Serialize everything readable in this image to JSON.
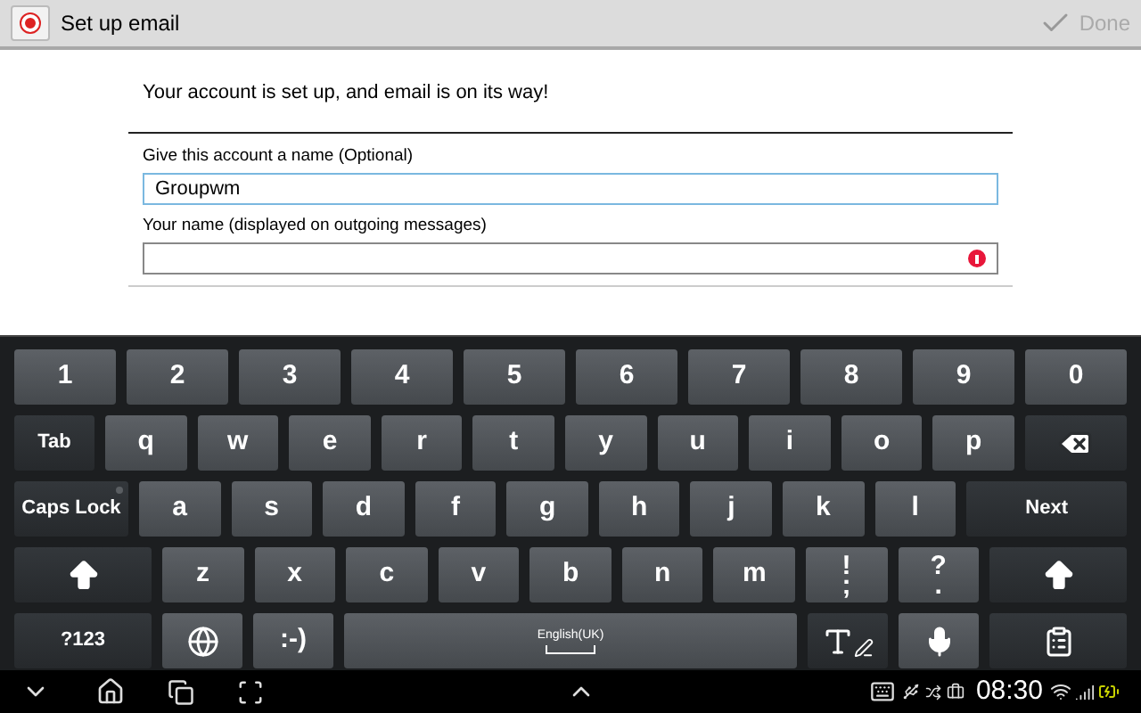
{
  "action_bar": {
    "title": "Set up email",
    "done": {
      "label": "Done",
      "disabled": true
    }
  },
  "message": "Your account is set up, and email is on its way!",
  "fields": [
    {
      "label": "Give this account a name (Optional)",
      "value": "Groupwm",
      "focused": true,
      "error": false
    },
    {
      "label": "Your name (displayed on outgoing messages)",
      "focused": false,
      "error": true
    }
  ],
  "keyboard": {
    "rows": [
      [
        {
          "kind": "digit",
          "label": "1"
        },
        {
          "kind": "digit",
          "label": "2"
        },
        {
          "kind": "digit",
          "label": "3"
        },
        {
          "kind": "digit",
          "label": "4"
        },
        {
          "kind": "digit",
          "label": "5"
        },
        {
          "kind": "digit",
          "label": "6"
        },
        {
          "kind": "digit",
          "label": "7"
        },
        {
          "kind": "digit",
          "label": "8"
        },
        {
          "kind": "digit",
          "label": "9"
        },
        {
          "kind": "digit",
          "label": "0"
        }
      ],
      [
        {
          "kind": "tab",
          "label": "Tab"
        },
        {
          "kind": "char",
          "label": "q"
        },
        {
          "kind": "char",
          "label": "w"
        },
        {
          "kind": "char",
          "label": "e"
        },
        {
          "kind": "char",
          "label": "r"
        },
        {
          "kind": "char",
          "label": "t"
        },
        {
          "kind": "char",
          "label": "y"
        },
        {
          "kind": "char",
          "label": "u"
        },
        {
          "kind": "char",
          "label": "i"
        },
        {
          "kind": "char",
          "label": "o"
        },
        {
          "kind": "char",
          "label": "p"
        },
        {
          "kind": "backspace"
        }
      ],
      [
        {
          "kind": "caps",
          "label": "Caps Lock",
          "on": false
        },
        {
          "kind": "char",
          "label": "a"
        },
        {
          "kind": "char",
          "label": "s"
        },
        {
          "kind": "char",
          "label": "d"
        },
        {
          "kind": "char",
          "label": "f"
        },
        {
          "kind": "char",
          "label": "g"
        },
        {
          "kind": "char",
          "label": "h"
        },
        {
          "kind": "char",
          "label": "j"
        },
        {
          "kind": "char",
          "label": "k"
        },
        {
          "kind": "char",
          "label": "l"
        },
        {
          "kind": "next",
          "label": "Next"
        }
      ],
      [
        {
          "kind": "shift"
        },
        {
          "kind": "char",
          "label": "z"
        },
        {
          "kind": "char",
          "label": "x"
        },
        {
          "kind": "char",
          "label": "c"
        },
        {
          "kind": "char",
          "label": "v"
        },
        {
          "kind": "char",
          "label": "b"
        },
        {
          "kind": "char",
          "label": "n"
        },
        {
          "kind": "char",
          "label": "m"
        },
        {
          "kind": "punct",
          "label": "!",
          "sub": ";"
        },
        {
          "kind": "punct",
          "label": "?",
          "sub": "."
        },
        {
          "kind": "shift"
        }
      ],
      [
        {
          "kind": "symbols",
          "label": "?123"
        },
        {
          "kind": "globe"
        },
        {
          "kind": "char",
          "label": ":-)"
        },
        {
          "kind": "space",
          "label": "English(UK)"
        },
        {
          "kind": "handwriting"
        },
        {
          "kind": "mic"
        },
        {
          "kind": "clipboard"
        }
      ]
    ]
  },
  "status_bar": {
    "time": "08:30"
  }
}
